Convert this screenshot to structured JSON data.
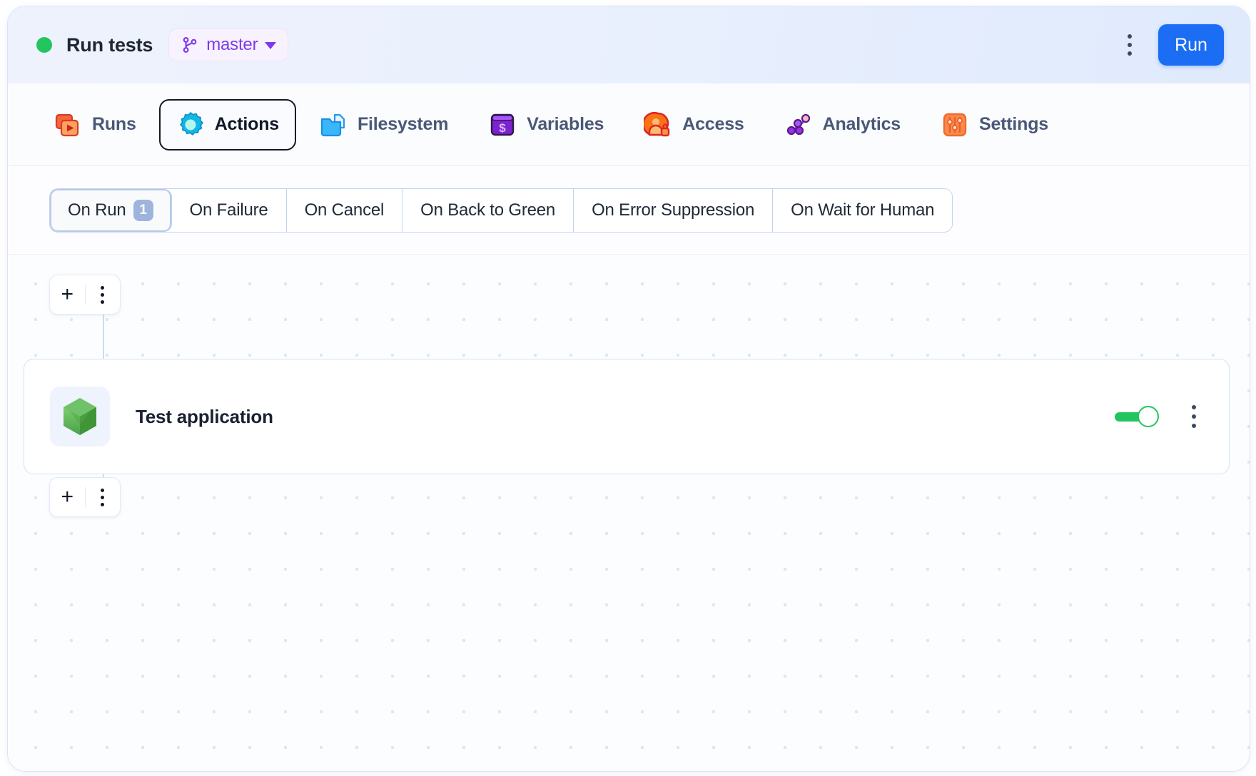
{
  "header": {
    "status": "running",
    "status_color": "#22c55e",
    "title": "Run tests",
    "branch": "master",
    "branch_icon": "git-branch-icon",
    "branch_caret_icon": "chevron-down-icon",
    "menu_icon": "kebab-menu-icon",
    "run_label": "Run",
    "run_color": "#1b6ef3"
  },
  "nav": {
    "tabs": [
      {
        "label": "Runs",
        "icon": "runs-icon",
        "active": false
      },
      {
        "label": "Actions",
        "icon": "actions-icon",
        "active": true
      },
      {
        "label": "Filesystem",
        "icon": "filesystem-icon",
        "active": false
      },
      {
        "label": "Variables",
        "icon": "variables-icon",
        "active": false
      },
      {
        "label": "Access",
        "icon": "access-icon",
        "active": false
      },
      {
        "label": "Analytics",
        "icon": "analytics-icon",
        "active": false
      },
      {
        "label": "Settings",
        "icon": "settings-icon",
        "active": false
      }
    ]
  },
  "subtabs": {
    "items": [
      {
        "label": "On Run",
        "badge": "1",
        "active": true
      },
      {
        "label": "On Failure",
        "badge": null,
        "active": false
      },
      {
        "label": "On Cancel",
        "badge": null,
        "active": false
      },
      {
        "label": "On Back to Green",
        "badge": null,
        "active": false
      },
      {
        "label": "On Error Suppression",
        "badge": null,
        "active": false
      },
      {
        "label": "On Wait for Human",
        "badge": null,
        "active": false
      }
    ]
  },
  "canvas": {
    "add_top": {
      "plus_label": "+",
      "plus_icon": "plus-icon",
      "menu_icon": "kebab-menu-icon"
    },
    "add_bottom": {
      "plus_label": "+",
      "plus_icon": "plus-icon",
      "menu_icon": "kebab-menu-icon"
    },
    "action": {
      "title": "Test application",
      "icon": "nodejs-hexagon-icon",
      "enabled": true,
      "toggle_color": "#22c55e",
      "menu_icon": "kebab-menu-icon"
    }
  }
}
